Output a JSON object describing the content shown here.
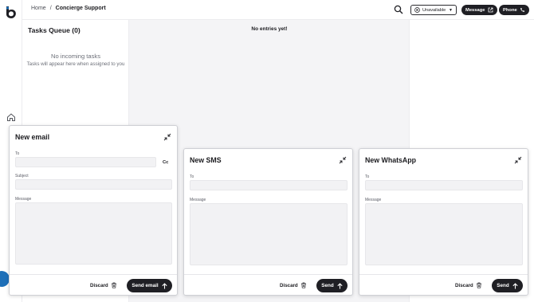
{
  "header": {
    "breadcrumb": {
      "home": "Home",
      "separator": "/",
      "current": "Concierge Support"
    },
    "status": {
      "label": "Unavailable",
      "icon": "circle-x-icon"
    },
    "message_label": "Message",
    "phone_label": "Phone"
  },
  "queue": {
    "title": "Tasks Queue (0)",
    "empty_title": "No incoming tasks",
    "empty_subtitle": "Tasks will appear here when assigned to you"
  },
  "main": {
    "empty_text": "No entries yet!"
  },
  "compose": {
    "email": {
      "title": "New email",
      "to_label": "To",
      "cc_label": "Cc",
      "subject_label": "Subject",
      "message_label": "Message",
      "discard_label": "Discard",
      "send_label": "Send email"
    },
    "sms": {
      "title": "New SMS",
      "to_label": "To",
      "message_label": "Message",
      "discard_label": "Discard",
      "send_label": "Send"
    },
    "whatsapp": {
      "title": "New WhatsApp",
      "to_label": "To",
      "message_label": "Message",
      "discard_label": "Discard",
      "send_label": "Send"
    }
  },
  "colors": {
    "primary": "#1f1f24",
    "accent_blue": "#1d6fb8",
    "panel_bg": "#f4f4f6",
    "field_bg": "#f2f2f4"
  }
}
